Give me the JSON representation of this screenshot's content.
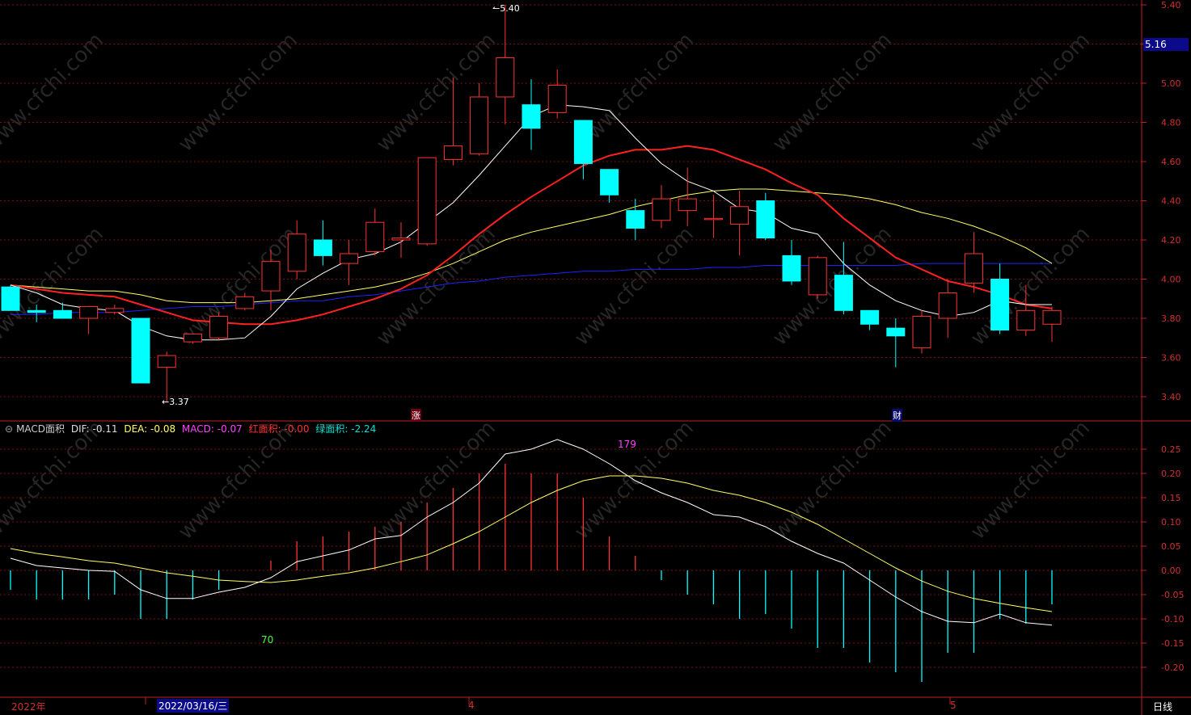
{
  "price_axis": {
    "ticks": [
      "5.40",
      "5.20",
      "5.00",
      "4.80",
      "4.60",
      "4.40",
      "4.20",
      "4.00",
      "3.80",
      "3.60",
      "3.40"
    ],
    "current_price": "5.16"
  },
  "macd_axis": {
    "ticks": [
      "0.25",
      "0.20",
      "0.15",
      "0.10",
      "0.05",
      "0.00",
      "-0.05",
      "-0.10",
      "-0.15",
      "-0.20"
    ]
  },
  "legend": {
    "name": "MACD面积",
    "dif": "DIF: -0.11",
    "dea": "DEA: -0.08",
    "macd": "MACD: -0.07",
    "red_area": "红面积: -0.00",
    "green_area": "绿面积: -2.24"
  },
  "annotations": {
    "high": "5.40",
    "low": "3.37",
    "red_count": "179",
    "green_count": "70",
    "marker_zhang": "涨",
    "marker_cai": "财"
  },
  "time_axis": {
    "year_label": "2022年",
    "cursor_date": "2022/03/16/三",
    "month_april": "4",
    "month_may": "5",
    "period": "日线"
  },
  "watermark": "www.cfchi.com",
  "colors": {
    "up": "#ff3232",
    "down": "#00ffff",
    "ma5": "#ffffff",
    "ma10": "#ff2020",
    "ma20": "#ffff66",
    "ma60": "#2020ff",
    "dif": "#ffffff",
    "dea": "#ffff66",
    "grid": "#7a1010"
  },
  "chart_data": [
    {
      "type": "candlestick",
      "title": "",
      "ylim": [
        3.3,
        5.45
      ],
      "candles": [
        {
          "o": 3.96,
          "h": 3.97,
          "l": 3.84,
          "c": 3.84
        },
        {
          "o": 3.84,
          "h": 3.87,
          "l": 3.78,
          "c": 3.83
        },
        {
          "o": 3.84,
          "h": 3.88,
          "l": 3.83,
          "c": 3.8
        },
        {
          "o": 3.8,
          "h": 3.86,
          "l": 3.72,
          "c": 3.86
        },
        {
          "o": 3.83,
          "h": 3.87,
          "l": 3.82,
          "c": 3.85
        },
        {
          "o": 3.8,
          "h": 3.8,
          "l": 3.47,
          "c": 3.47
        },
        {
          "o": 3.55,
          "h": 3.63,
          "l": 3.37,
          "c": 3.61
        },
        {
          "o": 3.68,
          "h": 3.72,
          "l": 3.67,
          "c": 3.72
        },
        {
          "o": 3.7,
          "h": 3.83,
          "l": 3.69,
          "c": 3.81
        },
        {
          "o": 3.85,
          "h": 3.93,
          "l": 3.84,
          "c": 3.91
        },
        {
          "o": 3.94,
          "h": 4.15,
          "l": 3.84,
          "c": 4.09
        },
        {
          "o": 4.04,
          "h": 4.3,
          "l": 4.0,
          "c": 4.23
        },
        {
          "o": 4.2,
          "h": 4.3,
          "l": 4.07,
          "c": 4.12
        },
        {
          "o": 4.08,
          "h": 4.2,
          "l": 3.97,
          "c": 4.13
        },
        {
          "o": 4.14,
          "h": 4.36,
          "l": 4.12,
          "c": 4.29
        },
        {
          "o": 4.2,
          "h": 4.29,
          "l": 4.11,
          "c": 4.21
        },
        {
          "o": 4.18,
          "h": 4.62,
          "l": 4.17,
          "c": 4.62
        },
        {
          "o": 4.61,
          "h": 5.03,
          "l": 4.58,
          "c": 4.68
        },
        {
          "o": 4.64,
          "h": 5.0,
          "l": 4.63,
          "c": 4.93
        },
        {
          "o": 4.93,
          "h": 5.4,
          "l": 4.79,
          "c": 5.13
        },
        {
          "o": 4.89,
          "h": 5.02,
          "l": 4.66,
          "c": 4.77
        },
        {
          "o": 4.85,
          "h": 5.07,
          "l": 4.82,
          "c": 4.99
        },
        {
          "o": 4.81,
          "h": 4.81,
          "l": 4.51,
          "c": 4.59
        },
        {
          "o": 4.56,
          "h": 4.56,
          "l": 4.39,
          "c": 4.43
        },
        {
          "o": 4.35,
          "h": 4.41,
          "l": 4.2,
          "c": 4.26
        },
        {
          "o": 4.3,
          "h": 4.48,
          "l": 4.26,
          "c": 4.41
        },
        {
          "o": 4.35,
          "h": 4.57,
          "l": 4.27,
          "c": 4.41
        },
        {
          "o": 4.31,
          "h": 4.43,
          "l": 4.21,
          "c": 4.31
        },
        {
          "o": 4.28,
          "h": 4.45,
          "l": 4.12,
          "c": 4.37
        },
        {
          "o": 4.4,
          "h": 4.44,
          "l": 4.2,
          "c": 4.21
        },
        {
          "o": 4.12,
          "h": 4.2,
          "l": 3.97,
          "c": 3.99
        },
        {
          "o": 3.92,
          "h": 4.12,
          "l": 3.9,
          "c": 4.11
        },
        {
          "o": 4.02,
          "h": 4.19,
          "l": 3.82,
          "c": 3.84
        },
        {
          "o": 3.84,
          "h": 3.84,
          "l": 3.74,
          "c": 3.77
        },
        {
          "o": 3.75,
          "h": 3.8,
          "l": 3.55,
          "c": 3.71
        },
        {
          "o": 3.65,
          "h": 3.84,
          "l": 3.62,
          "c": 3.81
        },
        {
          "o": 3.8,
          "h": 4.0,
          "l": 3.7,
          "c": 3.93
        },
        {
          "o": 3.98,
          "h": 4.24,
          "l": 3.93,
          "c": 4.13
        },
        {
          "o": 4.0,
          "h": 4.08,
          "l": 3.72,
          "c": 3.74
        },
        {
          "o": 3.74,
          "h": 3.97,
          "l": 3.71,
          "c": 3.84
        },
        {
          "o": 3.77,
          "h": 3.86,
          "l": 3.68,
          "c": 3.84
        }
      ],
      "ma5": [
        3.97,
        3.93,
        3.87,
        3.85,
        3.84,
        3.76,
        3.71,
        3.69,
        3.69,
        3.7,
        3.81,
        3.95,
        4.03,
        4.1,
        4.13,
        4.19,
        4.29,
        4.39,
        4.53,
        4.68,
        4.83,
        4.89,
        4.88,
        4.86,
        4.72,
        4.59,
        4.5,
        4.45,
        4.36,
        4.34,
        4.26,
        4.23,
        4.08,
        3.97,
        3.89,
        3.84,
        3.81,
        3.83,
        3.89,
        3.87,
        3.87
      ],
      "ma10": [
        3.97,
        3.95,
        3.93,
        3.92,
        3.91,
        3.87,
        3.83,
        3.79,
        3.78,
        3.77,
        3.77,
        3.79,
        3.82,
        3.86,
        3.9,
        3.95,
        4.02,
        4.12,
        4.23,
        4.33,
        4.42,
        4.5,
        4.58,
        4.63,
        4.66,
        4.66,
        4.68,
        4.66,
        4.61,
        4.56,
        4.49,
        4.43,
        4.31,
        4.21,
        4.11,
        4.05,
        3.99,
        3.96,
        3.92,
        3.87,
        3.85
      ],
      "ma20": [
        3.97,
        3.96,
        3.95,
        3.94,
        3.94,
        3.92,
        3.89,
        3.88,
        3.88,
        3.88,
        3.89,
        3.9,
        3.92,
        3.94,
        3.96,
        3.99,
        4.03,
        4.08,
        4.14,
        4.2,
        4.24,
        4.27,
        4.3,
        4.33,
        4.37,
        4.4,
        4.43,
        4.45,
        4.46,
        4.46,
        4.45,
        4.44,
        4.43,
        4.41,
        4.38,
        4.34,
        4.31,
        4.27,
        4.22,
        4.16,
        4.08
      ],
      "ma60": [
        3.82,
        3.82,
        3.83,
        3.83,
        3.83,
        3.84,
        3.85,
        3.86,
        3.86,
        3.87,
        3.88,
        3.89,
        3.89,
        3.91,
        3.92,
        3.94,
        3.96,
        3.98,
        3.99,
        4.01,
        4.02,
        4.03,
        4.04,
        4.04,
        4.05,
        4.05,
        4.05,
        4.06,
        4.06,
        4.07,
        4.07,
        4.07,
        4.07,
        4.07,
        4.07,
        4.08,
        4.08,
        4.08,
        4.08,
        4.08,
        4.08
      ]
    },
    {
      "type": "bar",
      "title": "MACD",
      "ylim": [
        -0.22,
        0.28
      ],
      "macd": [
        -0.04,
        -0.06,
        -0.06,
        -0.06,
        -0.05,
        -0.1,
        -0.1,
        -0.06,
        -0.04,
        0.0,
        0.02,
        0.06,
        0.07,
        0.08,
        0.09,
        0.1,
        0.14,
        0.17,
        0.2,
        0.22,
        0.2,
        0.2,
        0.15,
        0.07,
        0.03,
        -0.02,
        -0.05,
        -0.07,
        -0.1,
        -0.09,
        -0.12,
        -0.16,
        -0.16,
        -0.19,
        -0.21,
        -0.23,
        -0.17,
        -0.17,
        -0.1,
        -0.11,
        -0.07
      ],
      "dif": [
        0.025,
        0.01,
        0.005,
        0.0,
        -0.002,
        -0.04,
        -0.058,
        -0.058,
        -0.045,
        -0.035,
        -0.015,
        0.018,
        0.03,
        0.042,
        0.065,
        0.072,
        0.11,
        0.14,
        0.18,
        0.24,
        0.25,
        0.27,
        0.25,
        0.22,
        0.185,
        0.16,
        0.14,
        0.115,
        0.11,
        0.09,
        0.06,
        0.035,
        0.015,
        -0.02,
        -0.055,
        -0.085,
        -0.105,
        -0.108,
        -0.09,
        -0.108,
        -0.113
      ],
      "dea": [
        0.045,
        0.035,
        0.028,
        0.02,
        0.015,
        0.005,
        -0.005,
        -0.012,
        -0.02,
        -0.023,
        -0.025,
        -0.02,
        -0.012,
        -0.005,
        0.005,
        0.018,
        0.032,
        0.055,
        0.08,
        0.11,
        0.14,
        0.165,
        0.185,
        0.195,
        0.195,
        0.19,
        0.18,
        0.165,
        0.155,
        0.14,
        0.12,
        0.095,
        0.065,
        0.035,
        0.005,
        -0.022,
        -0.043,
        -0.058,
        -0.068,
        -0.077,
        -0.085
      ]
    }
  ]
}
